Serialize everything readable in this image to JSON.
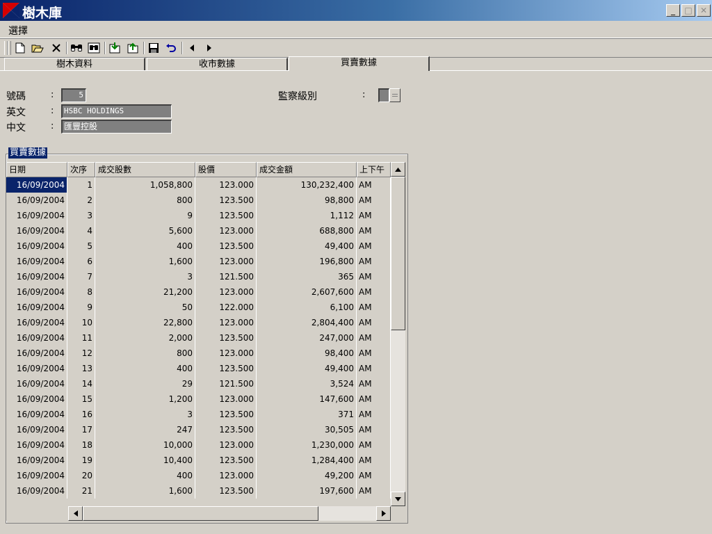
{
  "window": {
    "title": "樹木庫",
    "minimize": "_",
    "maximize": "□",
    "close": "✕",
    "colors": {
      "titlebar_start": "#0a246a",
      "titlebar_end": "#a6caf0",
      "face": "#d4d0c8"
    }
  },
  "menu": {
    "items": [
      "選擇"
    ]
  },
  "toolbar": {
    "icons": [
      "new-file-icon",
      "open-folder-icon",
      "delete-icon",
      "find-icon",
      "find-replace-icon",
      "import-icon",
      "export-icon",
      "save-icon",
      "undo-icon",
      "previous-icon",
      "next-icon"
    ]
  },
  "tabs": [
    {
      "label": "樹木資料",
      "active": false
    },
    {
      "label": "收市數據",
      "active": false
    },
    {
      "label": "買賣數據",
      "active": true
    }
  ],
  "form": {
    "code_label": "號碼",
    "code_value": "5",
    "english_label": "英文",
    "english_value": "HSBC HOLDINGS",
    "chinese_label": "中文",
    "chinese_value": "匯豐控股",
    "monitor_label": "監察級別",
    "colon": ":"
  },
  "group": {
    "title": "買賣數據"
  },
  "grid": {
    "columns": [
      "日期",
      "次序",
      "成交股數",
      "股價",
      "成交金額",
      "上下午"
    ],
    "rows": [
      [
        "16/09/2004",
        "1",
        "1,058,800",
        "123.000",
        "130,232,400",
        "AM"
      ],
      [
        "16/09/2004",
        "2",
        "800",
        "123.500",
        "98,800",
        "AM"
      ],
      [
        "16/09/2004",
        "3",
        "9",
        "123.500",
        "1,112",
        "AM"
      ],
      [
        "16/09/2004",
        "4",
        "5,600",
        "123.000",
        "688,800",
        "AM"
      ],
      [
        "16/09/2004",
        "5",
        "400",
        "123.500",
        "49,400",
        "AM"
      ],
      [
        "16/09/2004",
        "6",
        "1,600",
        "123.000",
        "196,800",
        "AM"
      ],
      [
        "16/09/2004",
        "7",
        "3",
        "121.500",
        "365",
        "AM"
      ],
      [
        "16/09/2004",
        "8",
        "21,200",
        "123.000",
        "2,607,600",
        "AM"
      ],
      [
        "16/09/2004",
        "9",
        "50",
        "122.000",
        "6,100",
        "AM"
      ],
      [
        "16/09/2004",
        "10",
        "22,800",
        "123.000",
        "2,804,400",
        "AM"
      ],
      [
        "16/09/2004",
        "11",
        "2,000",
        "123.500",
        "247,000",
        "AM"
      ],
      [
        "16/09/2004",
        "12",
        "800",
        "123.000",
        "98,400",
        "AM"
      ],
      [
        "16/09/2004",
        "13",
        "400",
        "123.500",
        "49,400",
        "AM"
      ],
      [
        "16/09/2004",
        "14",
        "29",
        "121.500",
        "3,524",
        "AM"
      ],
      [
        "16/09/2004",
        "15",
        "1,200",
        "123.000",
        "147,600",
        "AM"
      ],
      [
        "16/09/2004",
        "16",
        "3",
        "123.500",
        "371",
        "AM"
      ],
      [
        "16/09/2004",
        "17",
        "247",
        "123.500",
        "30,505",
        "AM"
      ],
      [
        "16/09/2004",
        "18",
        "10,000",
        "123.000",
        "1,230,000",
        "AM"
      ],
      [
        "16/09/2004",
        "19",
        "10,400",
        "123.500",
        "1,284,400",
        "AM"
      ],
      [
        "16/09/2004",
        "20",
        "400",
        "123.000",
        "49,200",
        "AM"
      ],
      [
        "16/09/2004",
        "21",
        "1,600",
        "123.500",
        "197,600",
        "AM"
      ]
    ],
    "selected": {
      "row": 0,
      "col": 0
    }
  }
}
